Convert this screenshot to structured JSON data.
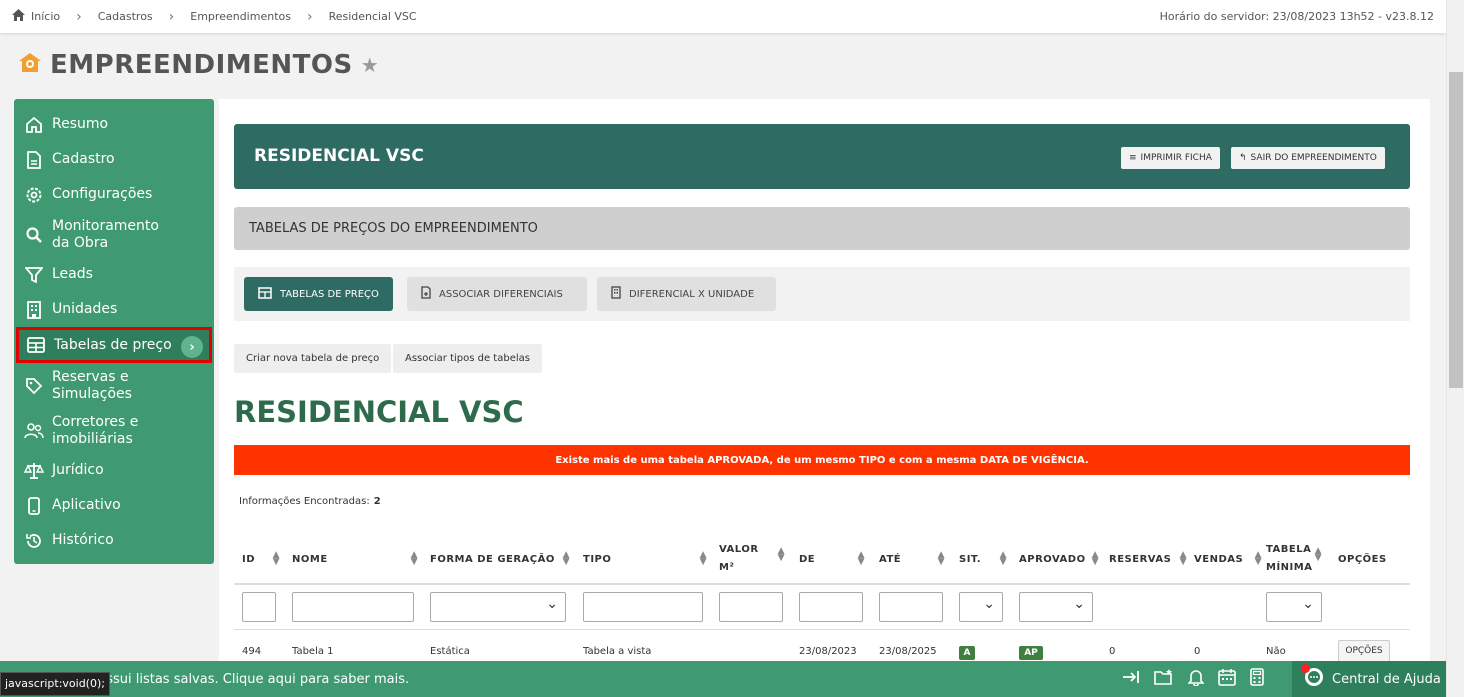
{
  "breadcrumb": [
    "Início",
    "Cadastros",
    "Empreendimentos",
    "Residencial VSC"
  ],
  "server_time": "Horário do servidor: 23/08/2023 13h52 - v23.8.12",
  "page": {
    "title": "EMPREENDIMENTOS"
  },
  "sidebar": {
    "items": [
      {
        "label": "Resumo",
        "icon": "home-icon"
      },
      {
        "label": "Cadastro",
        "icon": "document-icon"
      },
      {
        "label": "Configurações",
        "icon": "gear-icon"
      },
      {
        "label": "Monitoramento da Obra",
        "icon": "search-icon"
      },
      {
        "label": "Leads",
        "icon": "filter-icon"
      },
      {
        "label": "Unidades",
        "icon": "building-icon"
      },
      {
        "label": "Tabelas de preço",
        "icon": "table-icon",
        "active": true
      },
      {
        "label": "Reservas e Simulações",
        "icon": "tag-icon"
      },
      {
        "label": "Corretores e imobiliárias",
        "icon": "users-icon"
      },
      {
        "label": "Jurídico",
        "icon": "scale-icon"
      },
      {
        "label": "Aplicativo",
        "icon": "phone-icon"
      },
      {
        "label": "Histórico",
        "icon": "history-icon"
      }
    ]
  },
  "header": {
    "title": "RESIDENCIAL VSC",
    "print_label": "IMPRIMIR FICHA",
    "exit_label": "SAIR DO EMPREENDIMENTO"
  },
  "section_title": "TABELAS DE PREÇOS DO EMPREENDIMENTO",
  "tabs": [
    {
      "label": "TABELAS DE PREÇO",
      "active": true
    },
    {
      "label": "ASSOCIAR DIFERENCIAIS"
    },
    {
      "label": "DIFERENCIAL X UNIDADE"
    }
  ],
  "actions": {
    "create_label": "Criar nova tabela de preço",
    "assoc_label": "Associar tipos de tabelas"
  },
  "content_title": "RESIDENCIAL VSC",
  "alert": "Existe mais de uma tabela APROVADA, de um mesmo TIPO e com a mesma DATA DE VIGÊNCIA.",
  "info": {
    "label": "Informações Encontradas:",
    "count": "2"
  },
  "table": {
    "headers": {
      "id": "ID",
      "nome": "NOME",
      "forma": "FORMA DE GERAÇÃO",
      "tipo": "TIPO",
      "valor_1": "VALOR",
      "valor_2": "M²",
      "de": "DE",
      "ate": "ATÉ",
      "sit": "SIT.",
      "aprovado": "APROVADO",
      "reservas": "RESERVAS",
      "vendas": "VENDAS",
      "tabela_1": "TABELA",
      "tabela_2": "MÍNIMA",
      "opcoes": "OPÇÕES"
    },
    "row": {
      "id": "494",
      "nome": "Tabela 1",
      "forma": "Estática",
      "tipo": "Tabela a vista",
      "de": "23/08/2023",
      "ate": "23/08/2025",
      "sit": "A",
      "aprovado": "AP",
      "reservas": "0",
      "vendas": "0",
      "minima": "Não",
      "opcoes": "OPÇÕES"
    }
  },
  "bottom": {
    "message": "possui listas salvas. Clique aqui para saber mais.",
    "status_tip": "javascript:void(0);",
    "help_label": "Central de Ajuda"
  },
  "colors": {
    "primary": "#3f9a72",
    "header": "#2e6b62",
    "alert": "#ff3300"
  }
}
